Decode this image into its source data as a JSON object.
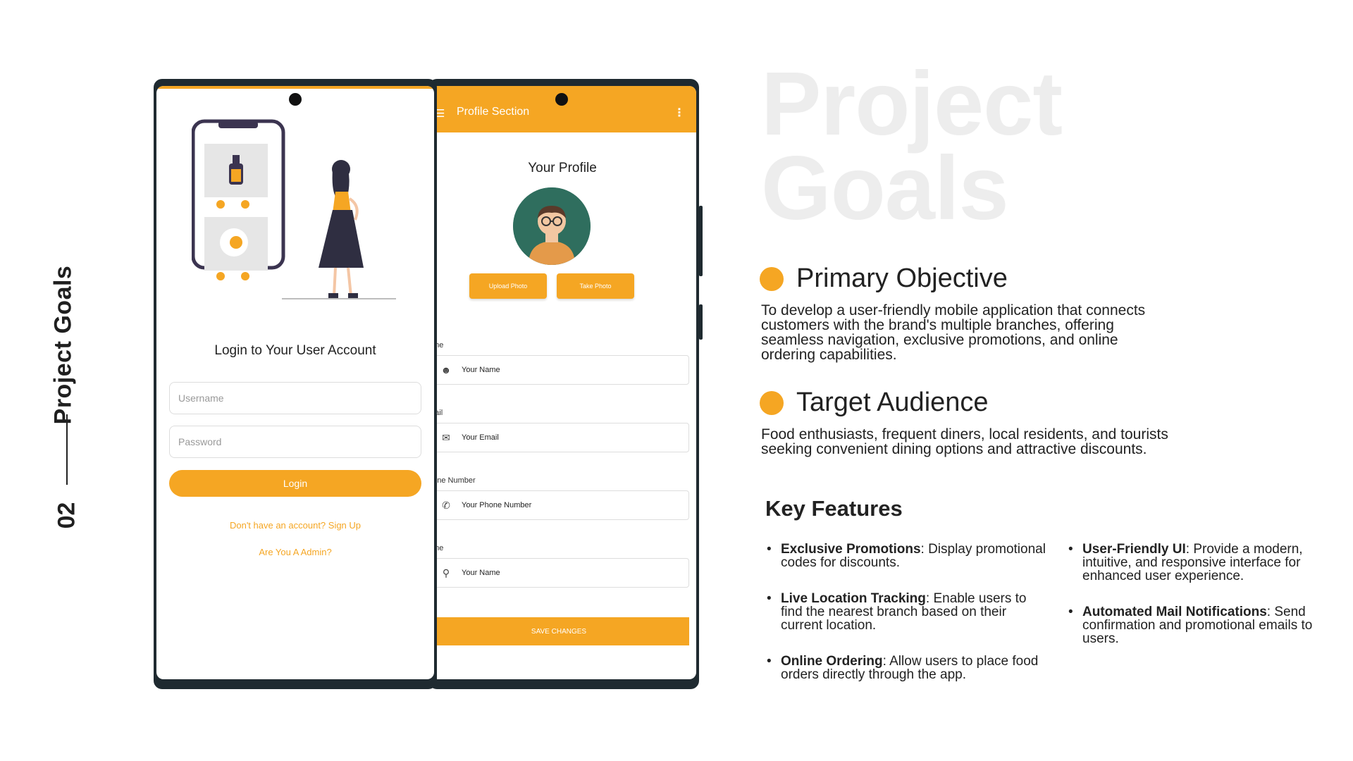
{
  "side": {
    "title": "Project Goals",
    "number": "02"
  },
  "login_screen": {
    "title": "Login to Your User Account",
    "username_placeholder": "Username",
    "password_placeholder": "Password",
    "login_label": "Login",
    "signup_link": "Don't have an account? Sign Up",
    "admin_link": "Are You A Admin?"
  },
  "profile_screen": {
    "appbar_title": "Profile Section",
    "heading": "Your Profile",
    "upload_photo": "Upload Photo",
    "take_photo": "Take Photo",
    "fields": [
      {
        "label": "ame",
        "value": "Your Name",
        "icon": "user-icon"
      },
      {
        "label": "mail",
        "value": "Your Email",
        "icon": "mail-icon"
      },
      {
        "label": "hone Number",
        "value": "Your Phone Number",
        "icon": "phone-icon"
      },
      {
        "label": "ame",
        "value": "Your Name",
        "icon": "location-pin-icon"
      }
    ],
    "save_label": "SAVE CHANGES"
  },
  "content": {
    "big_title_line1": "Project",
    "big_title_line2": "Goals",
    "primary": {
      "heading": "Primary Objective",
      "body": "To develop a user-friendly mobile application that connects customers with the brand's multiple branches, offering seamless navigation, exclusive promotions, and online ordering capabilities."
    },
    "audience": {
      "heading": "Target Audience",
      "body": "Food enthusiasts, frequent diners, local residents, and tourists seeking convenient dining options and attractive discounts."
    },
    "key_features_title": "Key Features",
    "features_left": [
      {
        "name": "Exclusive Promotions",
        "desc": ": Display promotional codes for discounts."
      },
      {
        "name": "Live Location Tracking",
        "desc": ": Enable users to find the nearest branch based on their current location."
      },
      {
        "name": "Online Ordering",
        "desc": ": Allow users to place food orders directly through the app."
      }
    ],
    "features_right": [
      {
        "name": "User-Friendly UI",
        "desc": ": Provide a modern, intuitive, and responsive interface for enhanced user experience."
      },
      {
        "name": "Automated Mail Notifications",
        "desc": ": Send confirmation and promotional emails to users."
      }
    ]
  },
  "colors": {
    "accent": "#f5a623",
    "phone_frame": "#1f2a30",
    "title_ghost": "#ededed"
  }
}
